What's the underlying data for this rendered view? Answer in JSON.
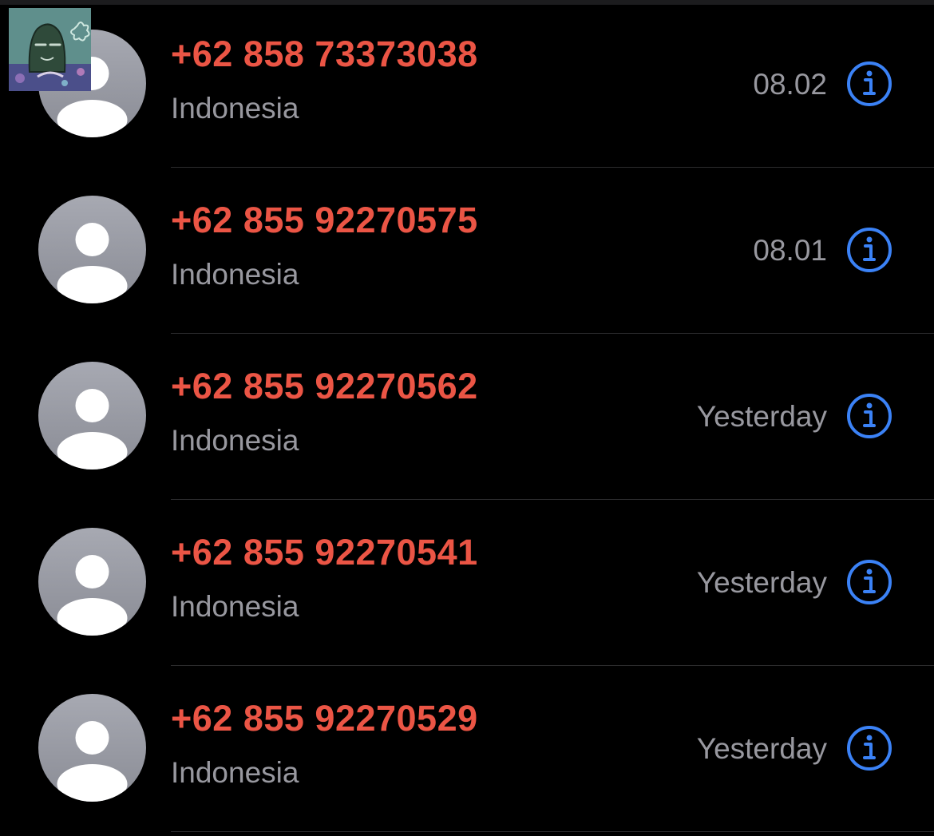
{
  "calls": [
    {
      "number": "+62 858 73373038",
      "location": "Indonesia",
      "time": "08.02"
    },
    {
      "number": "+62 855 92270575",
      "location": "Indonesia",
      "time": "08.01"
    },
    {
      "number": "+62 855 92270562",
      "location": "Indonesia",
      "time": "Yesterday"
    },
    {
      "number": "+62 855 92270541",
      "location": "Indonesia",
      "time": "Yesterday"
    },
    {
      "number": "+62 855 92270529",
      "location": "Indonesia",
      "time": "Yesterday"
    }
  ],
  "icons": {
    "avatar": "person-placeholder-icon",
    "info": "info-circle-icon",
    "overlay": "cartoon-sticker-thumbnail"
  },
  "colors": {
    "missed_call_number": "#eb5545",
    "secondary_text": "#98989f",
    "info_accent": "#3b82f6",
    "background": "#000000",
    "separator": "#2c2c2e"
  }
}
